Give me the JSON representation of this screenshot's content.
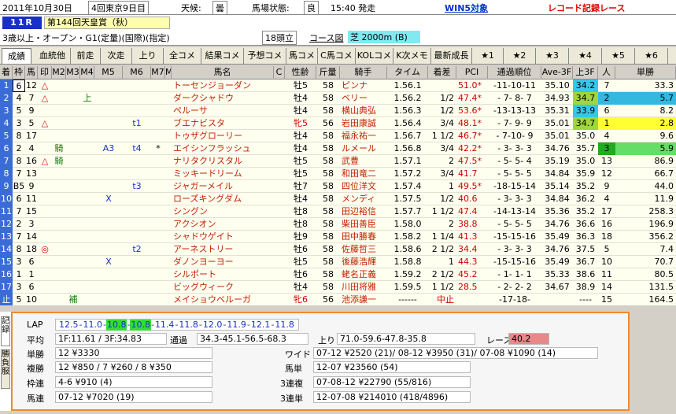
{
  "header": {
    "date": "2011年10月30日",
    "meeting": "4回東京9日目",
    "weather_label": "天候:",
    "weather": "曇",
    "track_label": "馬場状態:",
    "track": "良",
    "time": "15:40 発走",
    "win5": "WIN5対象",
    "record": "レコード記録レース"
  },
  "race": {
    "number": "11R",
    "name": "第144回天皇賞（秋）",
    "condition": "3歳以上・オープン・G1(定量)(国際)(指定)",
    "heads": "18頭立",
    "course_label": "コース図",
    "course": "芝 2000m (B)"
  },
  "tabs": [
    "成績",
    "血統他",
    "前走",
    "次走",
    "上り",
    "全コメ",
    "結果コメ",
    "予想コメ",
    "馬コメ",
    "C馬コメ",
    "KOLコメ",
    "K次メモ",
    "最新成長",
    "★1",
    "★2",
    "★3",
    "★4",
    "★5",
    "★6"
  ],
  "columns": [
    "着",
    "枠",
    "馬",
    "印",
    "M2",
    "M3",
    "M4",
    "M5",
    "M6",
    "M7",
    "M8",
    "馬名",
    "C",
    "性齢",
    "斤量",
    "騎手",
    "タイム",
    "着差",
    "PCI",
    "通過順位",
    "Ave-3F",
    "上3F",
    "人",
    "単勝"
  ],
  "rows": [
    {
      "rank": "1",
      "waku": "6",
      "uma": "12",
      "mark": "△",
      "m2": "",
      "m3": "",
      "m4": "",
      "m5": "",
      "m6": "",
      "m7": "",
      "name": "トーセンジョーダン",
      "c": "",
      "sex": "牡5",
      "kin": "58",
      "jockey": "ピンナ",
      "time": "1.56.1",
      "diff": "",
      "pci": "51.0*",
      "pass": "-11-10-11",
      "ave": "35.10",
      "up3": "34.2",
      "up3c": "#33c8e8",
      "pop": "7",
      "popc": "",
      "odds": "33.3",
      "oddsc": ""
    },
    {
      "rank": "2",
      "waku": "4",
      "uma": "7",
      "mark": "△",
      "m2": "",
      "m3": "",
      "m4": "上",
      "m5": "",
      "m6": "",
      "m7": "",
      "name": "ダークシャドウ",
      "c": "",
      "sex": "牡4",
      "kin": "58",
      "jockey": "ベリー",
      "time": "1.56.2",
      "diff": "1/2",
      "pci": "47.4*",
      "pass": "- 7- 8- 7",
      "ave": "34.93",
      "up3": "34.7",
      "up3c": "#9fd63a",
      "pop": "2",
      "popc": "#33b8e0",
      "odds": "5.7",
      "oddsc": "#33b8e0"
    },
    {
      "rank": "3",
      "waku": "5",
      "uma": "9",
      "mark": "",
      "m2": "",
      "m3": "",
      "m4": "",
      "m5": "",
      "m6": "",
      "m7": "",
      "name": "ペルーサ",
      "c": "",
      "sex": "牡4",
      "kin": "58",
      "jockey": "横山典弘",
      "time": "1.56.3",
      "diff": "1/2",
      "pci": "53.6*",
      "pass": "-13-13-13",
      "ave": "35.31",
      "up3": "33.9",
      "up3c": "#33c8e8",
      "pop": "6",
      "popc": "",
      "odds": "8.2",
      "oddsc": ""
    },
    {
      "rank": "4",
      "waku": "3",
      "uma": "5",
      "mark": "△",
      "m2": "",
      "m3": "",
      "m4": "",
      "m5": "",
      "m6": "t1",
      "m7": "",
      "name": "ブエナビスタ",
      "c": "",
      "sex": "牝5",
      "kin": "56",
      "jockey": "岩田康誠",
      "time": "1.56.4",
      "diff": "3/4",
      "pci": "48.1*",
      "pass": "- 7- 9- 9",
      "ave": "35.01",
      "up3": "34.7",
      "up3c": "#9fd63a",
      "pop": "1",
      "popc": "#ffff33",
      "odds": "2.8",
      "oddsc": "#ffff33"
    },
    {
      "rank": "5",
      "waku": "8",
      "uma": "17",
      "mark": "",
      "m2": "",
      "m3": "",
      "m4": "",
      "m5": "",
      "m6": "",
      "m7": "",
      "name": "トゥザグローリー",
      "c": "",
      "sex": "牡4",
      "kin": "58",
      "jockey": "福永祐一",
      "time": "1.56.7",
      "diff": "1 1/2",
      "pci": "46.7*",
      "pass": "- 7-10- 9",
      "ave": "35.01",
      "up3": "35.0",
      "up3c": "",
      "pop": "4",
      "popc": "",
      "odds": "9.6",
      "oddsc": ""
    },
    {
      "rank": "6",
      "waku": "2",
      "uma": "4",
      "mark": "",
      "m2": "騎",
      "m3": "",
      "m4": "",
      "m5": "A3",
      "m6": "t4",
      "m7": "*",
      "name": "エイシンフラッシュ",
      "c": "",
      "sex": "牡4",
      "kin": "58",
      "jockey": "ルメール",
      "time": "1.56.8",
      "diff": "3/4",
      "pci": "42.2*",
      "pass": "- 3- 3- 3",
      "ave": "34.76",
      "up3": "35.7",
      "up3c": "",
      "pop": "3",
      "popc": "#22aa22",
      "odds": "5.9",
      "oddsc": "#66dd66"
    },
    {
      "rank": "7",
      "waku": "8",
      "uma": "16",
      "mark": "△",
      "m2": "騎",
      "m3": "",
      "m4": "",
      "m5": "",
      "m6": "",
      "m7": "",
      "name": "ナリタクリスタル",
      "c": "",
      "sex": "牡5",
      "kin": "58",
      "jockey": "武豊",
      "time": "1.57.1",
      "diff": "2",
      "pci": "47.5*",
      "pass": "- 5- 5- 4",
      "ave": "35.19",
      "up3": "35.0",
      "up3c": "",
      "pop": "13",
      "popc": "",
      "odds": "86.9",
      "oddsc": ""
    },
    {
      "rank": "8",
      "waku": "7",
      "uma": "13",
      "mark": "",
      "m2": "",
      "m3": "",
      "m4": "",
      "m5": "",
      "m6": "",
      "m7": "",
      "name": "ミッキードリーム",
      "c": "",
      "sex": "牡5",
      "kin": "58",
      "jockey": "和田竜二",
      "time": "1.57.2",
      "diff": "3/4",
      "pci": "41.7",
      "pass": "- 5- 5- 5",
      "ave": "34.84",
      "up3": "35.9",
      "up3c": "",
      "pop": "12",
      "popc": "",
      "odds": "66.7",
      "oddsc": ""
    },
    {
      "rank": "9",
      "waku": "B5",
      "uma": "9",
      "mark": "",
      "m2": "",
      "m3": "",
      "m4": "",
      "m5": "",
      "m6": "t3",
      "m7": "",
      "name": "ジャガーメイル",
      "c": "",
      "sex": "牡7",
      "kin": "58",
      "jockey": "四位洋文",
      "time": "1.57.4",
      "diff": "1",
      "pci": "49.5*",
      "pass": "-18-15-14",
      "ave": "35.14",
      "up3": "35.2",
      "up3c": "",
      "pop": "9",
      "popc": "",
      "odds": "44.0",
      "oddsc": ""
    },
    {
      "rank": "10",
      "waku": "6",
      "uma": "11",
      "mark": "",
      "m2": "",
      "m3": "",
      "m4": "",
      "m5": "X",
      "m6": "",
      "m7": "",
      "name": "ローズキングダム",
      "c": "",
      "sex": "牡4",
      "kin": "58",
      "jockey": "メンディ",
      "time": "1.57.5",
      "diff": "1/2",
      "pci": "40.6",
      "pass": "- 3- 3- 3",
      "ave": "34.84",
      "up3": "36.2",
      "up3c": "",
      "pop": "4",
      "popc": "",
      "odds": "11.9",
      "oddsc": ""
    },
    {
      "rank": "11",
      "waku": "7",
      "uma": "15",
      "mark": "",
      "m2": "",
      "m3": "",
      "m4": "",
      "m5": "",
      "m6": "",
      "m7": "",
      "name": "シングン",
      "c": "",
      "sex": "牡8",
      "kin": "58",
      "jockey": "田辺裕信",
      "time": "1.57.7",
      "diff": "1 1/2",
      "pci": "47.4",
      "pass": "-14-13-14",
      "ave": "35.36",
      "up3": "35.2",
      "up3c": "",
      "pop": "17",
      "popc": "",
      "odds": "258.3",
      "oddsc": ""
    },
    {
      "rank": "12",
      "waku": "2",
      "uma": "3",
      "mark": "",
      "m2": "",
      "m3": "",
      "m4": "",
      "m5": "",
      "m6": "",
      "m7": "",
      "name": "アクシオン",
      "c": "",
      "sex": "牡8",
      "kin": "58",
      "jockey": "柴田善臣",
      "time": "1.58.0",
      "diff": "2",
      "pci": "38.8",
      "pass": "- 5- 5- 5",
      "ave": "34.76",
      "up3": "36.6",
      "up3c": "",
      "pop": "16",
      "popc": "",
      "odds": "196.9",
      "oddsc": ""
    },
    {
      "rank": "13",
      "waku": "7",
      "uma": "14",
      "mark": "",
      "m2": "",
      "m3": "",
      "m4": "",
      "m5": "",
      "m6": "",
      "m7": "",
      "name": "シャドウゲイト",
      "c": "",
      "sex": "牡9",
      "kin": "58",
      "jockey": "田中勝春",
      "time": "1.58.2",
      "diff": "1 1/4",
      "pci": "41.3",
      "pass": "-15-15-16",
      "ave": "35.49",
      "up3": "36.3",
      "up3c": "",
      "pop": "18",
      "popc": "",
      "odds": "356.2",
      "oddsc": ""
    },
    {
      "rank": "14",
      "waku": "8",
      "uma": "18",
      "mark": "◎",
      "m2": "",
      "m3": "",
      "m4": "",
      "m5": "",
      "m6": "t2",
      "m7": "",
      "name": "アーネストリー",
      "c": "",
      "sex": "牡6",
      "kin": "58",
      "jockey": "佐藤哲三",
      "time": "1.58.6",
      "diff": "2 1/2",
      "pci": "34.4",
      "pass": "- 3- 3- 3",
      "ave": "34.76",
      "up3": "37.5",
      "up3c": "",
      "pop": "5",
      "popc": "",
      "odds": "7.4",
      "oddsc": ""
    },
    {
      "rank": "15",
      "waku": "3",
      "uma": "6",
      "mark": "",
      "m2": "",
      "m3": "",
      "m4": "",
      "m5": "X",
      "m6": "",
      "m7": "",
      "name": "ダノンヨーヨー",
      "c": "",
      "sex": "牡5",
      "kin": "58",
      "jockey": "後藤浩輝",
      "time": "1.58.8",
      "diff": "1",
      "pci": "44.3",
      "pass": "-15-15-16",
      "ave": "35.49",
      "up3": "36.7",
      "up3c": "",
      "pop": "10",
      "popc": "",
      "odds": "70.7",
      "oddsc": ""
    },
    {
      "rank": "16",
      "waku": "1",
      "uma": "1",
      "mark": "",
      "m2": "",
      "m3": "",
      "m4": "",
      "m5": "",
      "m6": "",
      "m7": "",
      "name": "シルポート",
      "c": "",
      "sex": "牡6",
      "kin": "58",
      "jockey": "蛯名正義",
      "time": "1.59.2",
      "diff": "2 1/2",
      "pci": "45.2",
      "pass": "- 1- 1- 1",
      "ave": "35.33",
      "up3": "38.6",
      "up3c": "",
      "pop": "11",
      "popc": "",
      "odds": "80.5",
      "oddsc": ""
    },
    {
      "rank": "17",
      "waku": "3",
      "uma": "6",
      "mark": "",
      "m2": "",
      "m3": "",
      "m4": "",
      "m5": "",
      "m6": "",
      "m7": "",
      "name": "ビッグウィーク",
      "c": "",
      "sex": "牡4",
      "kin": "58",
      "jockey": "川田将雅",
      "time": "1.59.5",
      "diff": "1 1/2",
      "pci": "28.5",
      "pass": "- 2- 2- 2",
      "ave": "34.67",
      "up3": "38.9",
      "up3c": "",
      "pop": "14",
      "popc": "",
      "odds": "131.5",
      "oddsc": ""
    },
    {
      "rank": "止",
      "waku": "5",
      "uma": "10",
      "mark": "",
      "m2": "",
      "m3": "補",
      "m4": "",
      "m5": "",
      "m6": "",
      "m7": "",
      "name": "メイショウベルーガ",
      "c": "",
      "sex": "牝6",
      "kin": "56",
      "jockey": "池添謙一",
      "time": "------",
      "diff": "中止",
      "pci": "",
      "pass": "-17-18-",
      "ave": "",
      "up3": "----",
      "up3c": "",
      "pop": "15",
      "popc": "",
      "odds": "164.5",
      "oddsc": ""
    }
  ],
  "side_tabs": [
    "記録",
    "勝負服"
  ],
  "lap": {
    "label": "LAP",
    "segs": [
      {
        "v": "12.5",
        "c": ""
      },
      {
        "v": "11.0",
        "c": ""
      },
      {
        "v": "10.8",
        "c": "#33dd33"
      },
      {
        "v": "10.8",
        "c": "#33dd33"
      },
      {
        "v": "11.4",
        "c": ""
      },
      {
        "v": "11.8",
        "c": ""
      },
      {
        "v": "12.0",
        "c": ""
      },
      {
        "v": "11.9",
        "c": ""
      },
      {
        "v": "12.1",
        "c": ""
      },
      {
        "v": "11.8",
        "c": ""
      }
    ]
  },
  "avg": {
    "label": "平均",
    "value": "1F:11.61 / 3F:34.83",
    "pass_label": "通過",
    "pass": "34.3-45.1-56.5-68.3",
    "up_label": "上り",
    "up": "71.0-59.6-47.8-35.8",
    "pci_label": "レースPCI",
    "pci": "40.2"
  },
  "pay": {
    "tansho_label": "単勝",
    "tansho": "12 ¥3330",
    "fukusho_label": "複勝",
    "fukusho": "12 ¥850 / 7 ¥260 / 8 ¥350",
    "wakuren_label": "枠連",
    "wakuren": "4-6 ¥910 (4)",
    "umaren_label": "馬連",
    "umaren": "07-12 ¥7020 (19)",
    "wide_label": "ワイド",
    "wide": "07-12 ¥2520 (21)/ 08-12 ¥3950 (31)/ 07-08 ¥1090 (14)",
    "umatan_label": "馬単",
    "umatan": "12-07 ¥23560 (54)",
    "sanrenpuku_label": "3連複",
    "sanrenpuku": "07-08-12 ¥22790 (55/816)",
    "sanrentan_label": "3連単",
    "sanrentan": "12-07-08 ¥214010 (418/4896)"
  }
}
